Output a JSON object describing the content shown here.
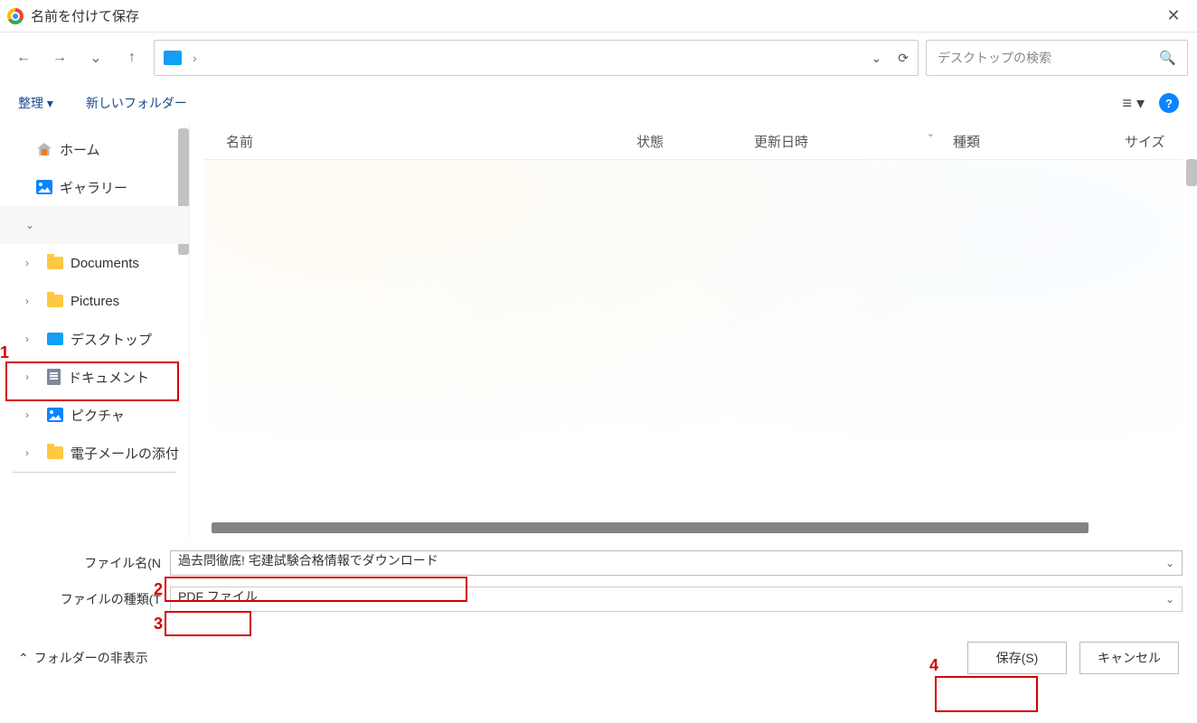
{
  "title": "名前を付けて保存",
  "search_placeholder": "デスクトップの検索",
  "toolbar": {
    "organize": "整理 ▾",
    "newfolder": "新しいフォルダー",
    "view_glyph": "≡ ▾",
    "help": "?"
  },
  "nav": {
    "back": "←",
    "fwd": "→",
    "recent": "⌄",
    "up": "↑",
    "refresh": "⟳",
    "dd": "⌄",
    "sep": "›"
  },
  "sidebar": {
    "home": "ホーム",
    "gallery": "ギャラリー",
    "section": "",
    "documents": "Documents",
    "pictures": "Pictures",
    "desktop": "デスクトップ",
    "docjp": "ドキュメント",
    "picjp": "ピクチャ",
    "email": "電子メールの添付"
  },
  "columns": {
    "name": "名前",
    "state": "状態",
    "date": "更新日時",
    "type": "種類",
    "size": "サイズ",
    "sort": "⌄"
  },
  "form": {
    "name_label": "ファイル名(N",
    "type_label": "ファイルの種類(T",
    "name_value": "過去問徹底! 宅建試験合格情報でダウンロード",
    "type_value": "PDF ファイル"
  },
  "buttons": {
    "hide": "フォルダーの非表示",
    "save": "保存(S)",
    "cancel": "キャンセル",
    "hide_arrow": "⌃"
  },
  "annotations": {
    "n1": "1",
    "n2": "2",
    "n3": "3",
    "n4": "4"
  }
}
